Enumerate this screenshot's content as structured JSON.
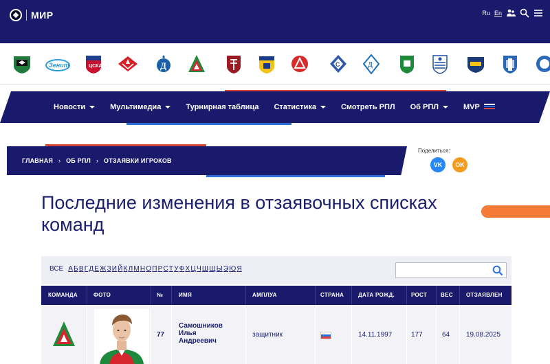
{
  "site": {
    "logo_text": "МИР",
    "lang_ru": "Ru",
    "lang_en": "En"
  },
  "clubs": [
    {
      "name": "krasnodar-logo",
      "color": "#1f7a3c"
    },
    {
      "name": "zenit-logo",
      "color": "#2a9ad8"
    },
    {
      "name": "cska-logo",
      "color": "#c8102e"
    },
    {
      "name": "spartak-logo",
      "color": "#d61f26"
    },
    {
      "name": "dynamo-logo",
      "color": "#1b5fa8"
    },
    {
      "name": "lokomotiv-logo",
      "color": "#d6262e"
    },
    {
      "name": "rubin-logo",
      "color": "#9b1b24"
    },
    {
      "name": "rostov-logo",
      "color": "#f3c316"
    },
    {
      "name": "akron-logo",
      "color": "#d82b2b"
    },
    {
      "name": "krylia-sovetov-logo",
      "color": "#2e58a8"
    },
    {
      "name": "dynamo-mkh-logo",
      "color": "#1d6fb8"
    },
    {
      "name": "akhmat-logo",
      "color": "#1e8a3a"
    },
    {
      "name": "baltika-logo",
      "color": "#1f4fa0"
    },
    {
      "name": "nizhny-novgorod-logo",
      "color": "#1a3a78"
    },
    {
      "name": "fakel-logo",
      "color": "#2767b5"
    },
    {
      "name": "orenburg-logo",
      "color": "#2a68b8"
    }
  ],
  "nav": {
    "items": [
      {
        "label": "Новости",
        "dropdown": true
      },
      {
        "label": "Мультимедиа",
        "dropdown": true
      },
      {
        "label": "Турнирная таблица",
        "dropdown": false
      },
      {
        "label": "Статистика",
        "dropdown": true
      },
      {
        "label": "Смотреть РПЛ",
        "dropdown": false
      },
      {
        "label": "Об РПЛ",
        "dropdown": true
      },
      {
        "label": "MVP",
        "dropdown": false
      }
    ]
  },
  "breadcrumb": [
    "ГЛАВНАЯ",
    "ОБ РПЛ",
    "ОТЗАЯВКИ ИГРОКОВ"
  ],
  "share": {
    "label": "Поделиться:",
    "vk": "VK",
    "ok": "OK"
  },
  "page_title": "Последние изменения в отзаявочных списках команд",
  "filter": {
    "all_label": "ВСЕ",
    "letters": [
      "А",
      "Б",
      "В",
      "Г",
      "Д",
      "Е",
      "Ж",
      "З",
      "И",
      "Й",
      "К",
      "Л",
      "М",
      "Н",
      "О",
      "П",
      "Р",
      "С",
      "Т",
      "У",
      "Ф",
      "Х",
      "Ц",
      "Ч",
      "Ш",
      "Щ",
      "Ы",
      "Э",
      "Ю",
      "Я"
    ],
    "search_value": ""
  },
  "table": {
    "headers": [
      "КОМАНДА",
      "ФОТО",
      "№",
      "ИМЯ",
      "АМПЛУА",
      "СТРАНА",
      "ДАТА РОЖД.",
      "РОСТ",
      "ВЕС",
      "ОТЗАЯВЛЕН"
    ],
    "rows": [
      {
        "team": "lokomotiv-logo",
        "number": "77",
        "name_line1": "Самошников",
        "name_line2": "Илья",
        "name_line3": "Андреевич",
        "position": "защитник",
        "country": "russia-flag",
        "birth_date": "14.11.1997",
        "height": "177",
        "weight": "64",
        "released": "19.08.2025"
      }
    ]
  },
  "colors": {
    "brand_navy": "#1a1a6c",
    "accent_red": "#d6453a",
    "accent_blue": "#2f6fd8",
    "accent_orange": "#f47a3a"
  }
}
